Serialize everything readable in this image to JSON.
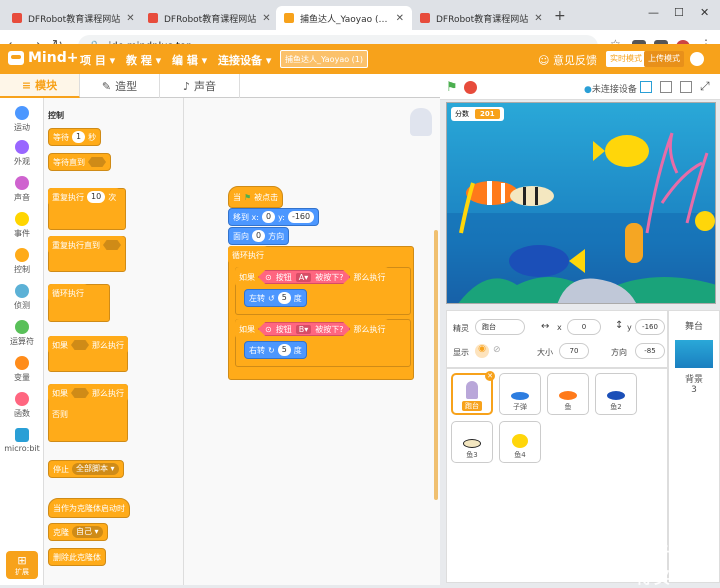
{
  "browser": {
    "tabs": [
      {
        "title": "DFRobot教育课程网站",
        "active": false
      },
      {
        "title": "DFRobot教育课程网站",
        "active": false
      },
      {
        "title": "捕鱼达人_Yaoyao (1) on Mind+",
        "active": true
      },
      {
        "title": "DFRobot教育课程网站",
        "active": false
      }
    ],
    "url": "ide.mindplus.top"
  },
  "app": {
    "logo": "Mind+",
    "menu": [
      "项 目",
      "教 程",
      "编 辑",
      "连接设备"
    ],
    "project_name": "捕鱼达人_Yaoyao (1)",
    "feedback": "意见反馈",
    "mode_realtime": "实时模式",
    "mode_upload": "上传模式"
  },
  "editor_tabs": [
    "模块",
    "造型",
    "声音"
  ],
  "categories": [
    {
      "label": "运动",
      "color": "#4c97ff"
    },
    {
      "label": "外观",
      "color": "#9966ff"
    },
    {
      "label": "声音",
      "color": "#cf63cf"
    },
    {
      "label": "事件",
      "color": "#ffd500"
    },
    {
      "label": "控制",
      "color": "#ffab19"
    },
    {
      "label": "侦测",
      "color": "#5cb1d6"
    },
    {
      "label": "运算符",
      "color": "#59c059"
    },
    {
      "label": "变量",
      "color": "#ff8c1a"
    },
    {
      "label": "函数",
      "color": "#ff6680"
    },
    {
      "label": "micro:bit",
      "color": "#2a9fd6"
    }
  ],
  "palette": {
    "title": "控制",
    "wait": {
      "text": "等待",
      "value": "1",
      "unit": "秒"
    },
    "wait_until": "等待直到",
    "repeat": {
      "text": "重复执行",
      "value": "10",
      "unit": "次"
    },
    "repeat_until": "重复执行直到",
    "forever": "循环执行",
    "if_label": "如果",
    "then_label": "那么执行",
    "else_label": "否则",
    "stop": {
      "text": "停止",
      "option": "全部脚本"
    },
    "clone_start": "当作为克隆体启动时",
    "clone": {
      "text": "克隆",
      "option": "自己"
    },
    "delete_clone": "删除此克隆体",
    "extensions": "扩展"
  },
  "script": {
    "hat_prefix": "当",
    "hat_suffix": "被点击",
    "goto": {
      "text": "移到 x:",
      "x": "0",
      "y_label": "y:",
      "y": "-160"
    },
    "direction": {
      "text": "面向",
      "value": "0",
      "unit": "方向"
    },
    "forever": "循环执行",
    "if1": {
      "if": "如果",
      "button": "按钮",
      "key": "A",
      "pressed": "被按下?",
      "then": "那么执行",
      "turn_text": "左转",
      "turn_value": "5",
      "turn_unit": "度"
    },
    "if2": {
      "if": "如果",
      "button": "按钮",
      "key": "B",
      "pressed": "被按下?",
      "then": "那么执行",
      "turn_text": "右转",
      "turn_value": "5",
      "turn_unit": "度"
    }
  },
  "stage": {
    "status": "未连接设备",
    "score_label": "分数",
    "score_value": "201"
  },
  "sprite_info": {
    "sprite_label": "精灵",
    "sprite_name": "跑台",
    "x": "0",
    "y_label": "y",
    "y": "-160",
    "show_label": "显示",
    "size_label": "大小",
    "size": "70",
    "direction_label": "方向",
    "direction": "-85"
  },
  "sprites": [
    "跑台",
    "子弹",
    "鱼",
    "鱼2",
    "鱼3",
    "鱼4"
  ],
  "backdrop_panel": {
    "title": "舞台",
    "label": "背景",
    "count": "3"
  },
  "watermark": "值 什么值得买"
}
